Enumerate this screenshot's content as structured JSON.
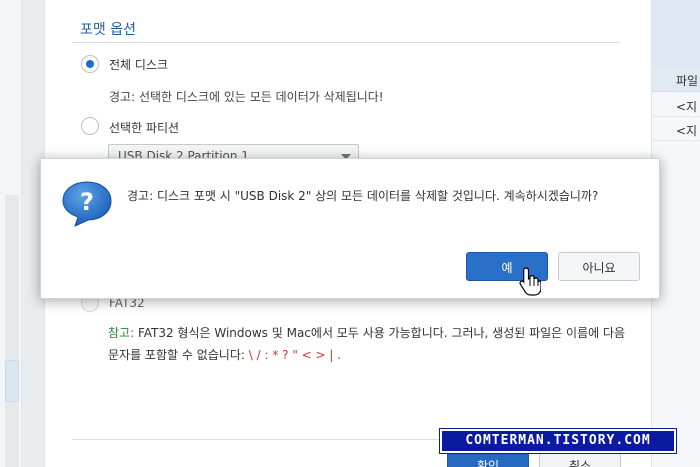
{
  "background": {
    "right_header": "파일",
    "right_rows": [
      "<지",
      "<지"
    ]
  },
  "wizard": {
    "section_title": "포맷 옵션",
    "options": {
      "full_disk": "전체 디스크",
      "full_disk_warning": "경고: 선택한 디스크에 있는 모든 데이터가 삭제됩니다!",
      "selected_partition": "선택한 파티션",
      "partition_select_value": "USB Disk 2 Partition 1",
      "fat32": "FAT32"
    },
    "selected_option": "full_disk",
    "note": {
      "label": "참고:",
      "text_1": " FAT32 형식은 Windows 및 Mac에서 모두 사용 가능합니다. 그러나, 생성된 파일은 이름에 다음 문자를 포함할 수 없습니다:",
      "forbidden_chars": "\\ / : * ? \" < > | ."
    },
    "footer": {
      "ok_label": "확인",
      "cancel_label": "취소"
    }
  },
  "dialog": {
    "icon": "question-icon",
    "message": "경고: 디스크 포맷 시 \"USB Disk 2\" 상의 모든 데이터를 삭제할 것입니다. 계속하시겠습니까?",
    "yes_label": "예",
    "no_label": "아니요"
  },
  "watermark": "COMTERMAN.TISTORY.COM",
  "colors": {
    "accent": "#2a6fc8",
    "title_blue": "#1f5fa8",
    "note_green": "#2a8a3a",
    "forbidden_red": "#d7352c",
    "watermark_bg": "#0b1aa0"
  }
}
